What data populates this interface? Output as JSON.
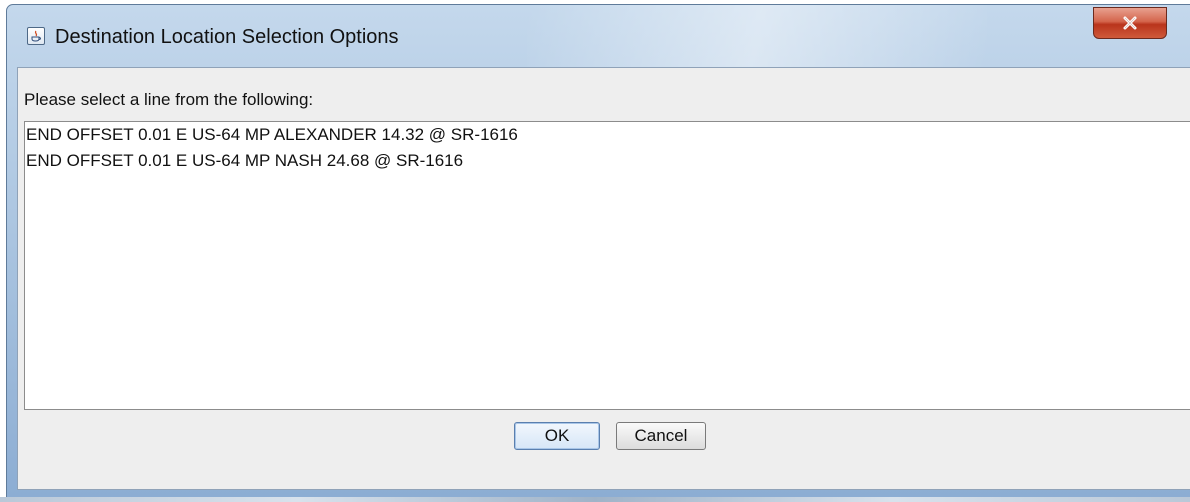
{
  "window": {
    "title": "Destination Location Selection Options",
    "app_icon": "java-cup-icon",
    "close_icon": "close-icon"
  },
  "dialog": {
    "prompt": "Please select a line from the following:",
    "options": [
      "END OFFSET 0.01 E US-64 MP ALEXANDER 14.32 @ SR-1616",
      "END OFFSET 0.01 E US-64 MP NASH 24.68 @ SR-1616"
    ]
  },
  "buttons": {
    "ok_label": "OK",
    "cancel_label": "Cancel"
  },
  "colors": {
    "titlebar": "#a6c1de",
    "close_button": "#c7452a",
    "client_background": "#eeeeee",
    "list_background": "#ffffff",
    "ok_border": "#5a7fae"
  }
}
